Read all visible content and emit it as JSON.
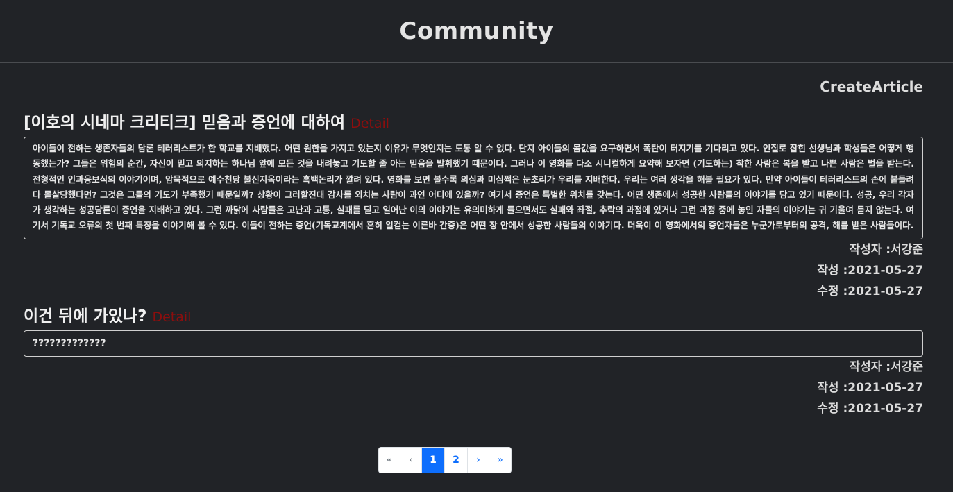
{
  "header": {
    "title": "Community"
  },
  "toolbar": {
    "create_label": "CreateArticle"
  },
  "articles": [
    {
      "title": "[이호의 시네마 크리티크] 믿음과 증언에 대하여",
      "detail_label": "Detail",
      "content": "아이들이 전하는 생존자들의 담론 테러리스트가 한 학교를 지배했다. 어떤 원한을 가지고 있는지 이유가 무엇인지는 도통 알 수 없다. 단지 아이들의 몸값을 요구하면서 폭탄이 터지기를 기다리고 있다. 인질로 잡힌 선생님과 학생들은 어떻게 행동했는가? 그들은 위험의 순간, 자신이 믿고 의지하는 하나님 앞에 모든 것을 내려놓고 기도할 줄 아는 믿음을 발휘했기 때문이다. 그러나 이 영화를 다소 시니컬하게 요약해 보자면 (기도하는) 착한 사람은 복을 받고 나쁜 사람은 벌을 받는다. 전형적인 인과응보식의 이야기이며, 암묵적으로 예수천당 불신지옥이라는 흑백논리가 깔려 있다. 영화를 보면 볼수록 의심과 미심쩍은 눈초리가 우리를 지배한다. 우리는 여러 생각을 해볼 필요가 있다. 만약 아이들이 테러리스트의 손에 붙들려 다 몰살당했다면? 그것은 그들의 기도가 부족했기 때문일까? 상황이 그러할진대 감사를 외치는 사람이 과연 어디에 있을까? 여기서 증언은 특별한 위치를 갖는다. 어떤 생존에서 성공한 사람들의 이야기를 담고 있기 때문이다. 성공, 우리 각자가 생각하는 성공담론이 증언을 지배하고 있다. 그런 까닭에 사람들은 고난과 고통, 실패를 딛고 일어난 이의 이야기는 유의미하게 들으면서도 실패와 좌절, 추락의 과정에 있거나 그런 과정 중에 놓인 자들의 이야기는 귀 기울여 듣지 않는다. 여기서 기독교 오류의 첫 번째 특징을 이야기해 볼 수 있다. 이들이 전하는 증언(기독교계에서 흔히 일컫는 이른바 간증)은 어떤 장 안에서 성공한 사람들의 이야기다. 더욱이 이 영화에서의 증언자들은 누군가로부터의 공격, 해를 받은 사람들이다.",
      "author_label": "작성자 :서강준",
      "created_label": "작성 :2021-05-27",
      "updated_label": "수정 :2021-05-27"
    },
    {
      "title": "이건 뒤에 가있나?",
      "detail_label": "Detail",
      "content": "?????????????",
      "author_label": "작성자 :서강준",
      "created_label": "작성 :2021-05-27",
      "updated_label": "수정 :2021-05-27"
    }
  ],
  "pagination": {
    "first": "«",
    "prev": "‹",
    "pages": [
      "1",
      "2"
    ],
    "current_page": 1,
    "next": "›",
    "last": "»"
  }
}
